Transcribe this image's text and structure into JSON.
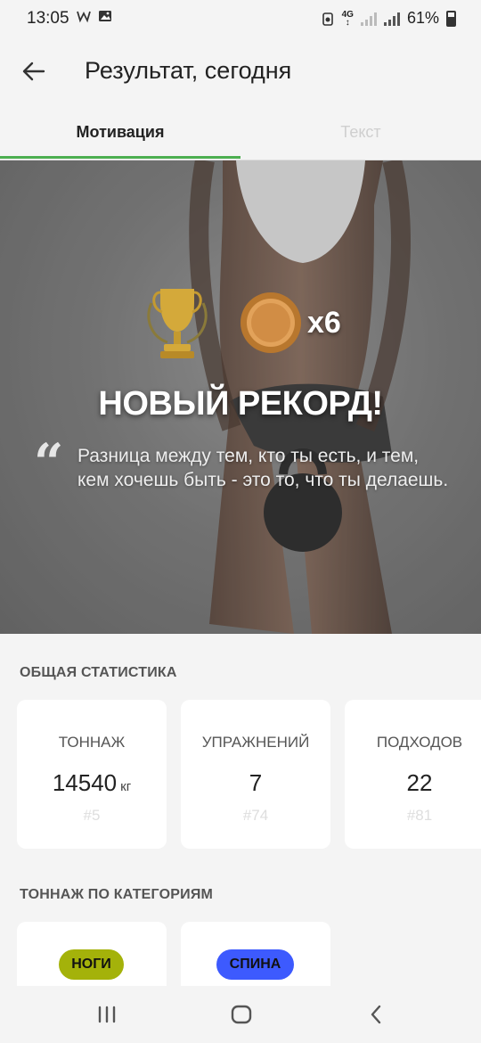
{
  "status_bar": {
    "time": "13:05",
    "battery": "61%",
    "icons": [
      "w-notification-icon",
      "gallery-icon",
      "recycle-icon",
      "4g-icon",
      "signal-icon",
      "signal-icon",
      "battery-icon"
    ]
  },
  "app_bar": {
    "title": "Результат, сегодня",
    "back_icon": "arrow-left-icon"
  },
  "tabs": [
    {
      "label": "Мотивация",
      "active": true
    },
    {
      "label": "Текст",
      "active": false
    }
  ],
  "hero": {
    "medal_count": "x6",
    "record_title": "НОВЫЙ РЕКОРД!",
    "quote": "Разница между тем, кто ты есть, и тем, кем хочешь быть - это то, что ты делаешь."
  },
  "stats": {
    "title": "ОБЩАЯ СТАТИСТИКА",
    "cards": [
      {
        "label": "ТОННАЖ",
        "value": "14540",
        "unit": "кг",
        "rank": "#5"
      },
      {
        "label": "УПРАЖНЕНИЙ",
        "value": "7",
        "unit": "",
        "rank": "#74"
      },
      {
        "label": "ПОДХОДОВ",
        "value": "22",
        "unit": "",
        "rank": "#81"
      }
    ]
  },
  "categories": {
    "title": "ТОННАЖ ПО КАТЕГОРИЯМ",
    "items": [
      {
        "label": "НОГИ",
        "color": "#a4b20a",
        "text_color": "#111111"
      },
      {
        "label": "СПИНА",
        "color": "#3d5afe",
        "text_color": "#111111"
      }
    ]
  },
  "colors": {
    "accent": "#4caf50",
    "background": "#f4f4f4"
  }
}
